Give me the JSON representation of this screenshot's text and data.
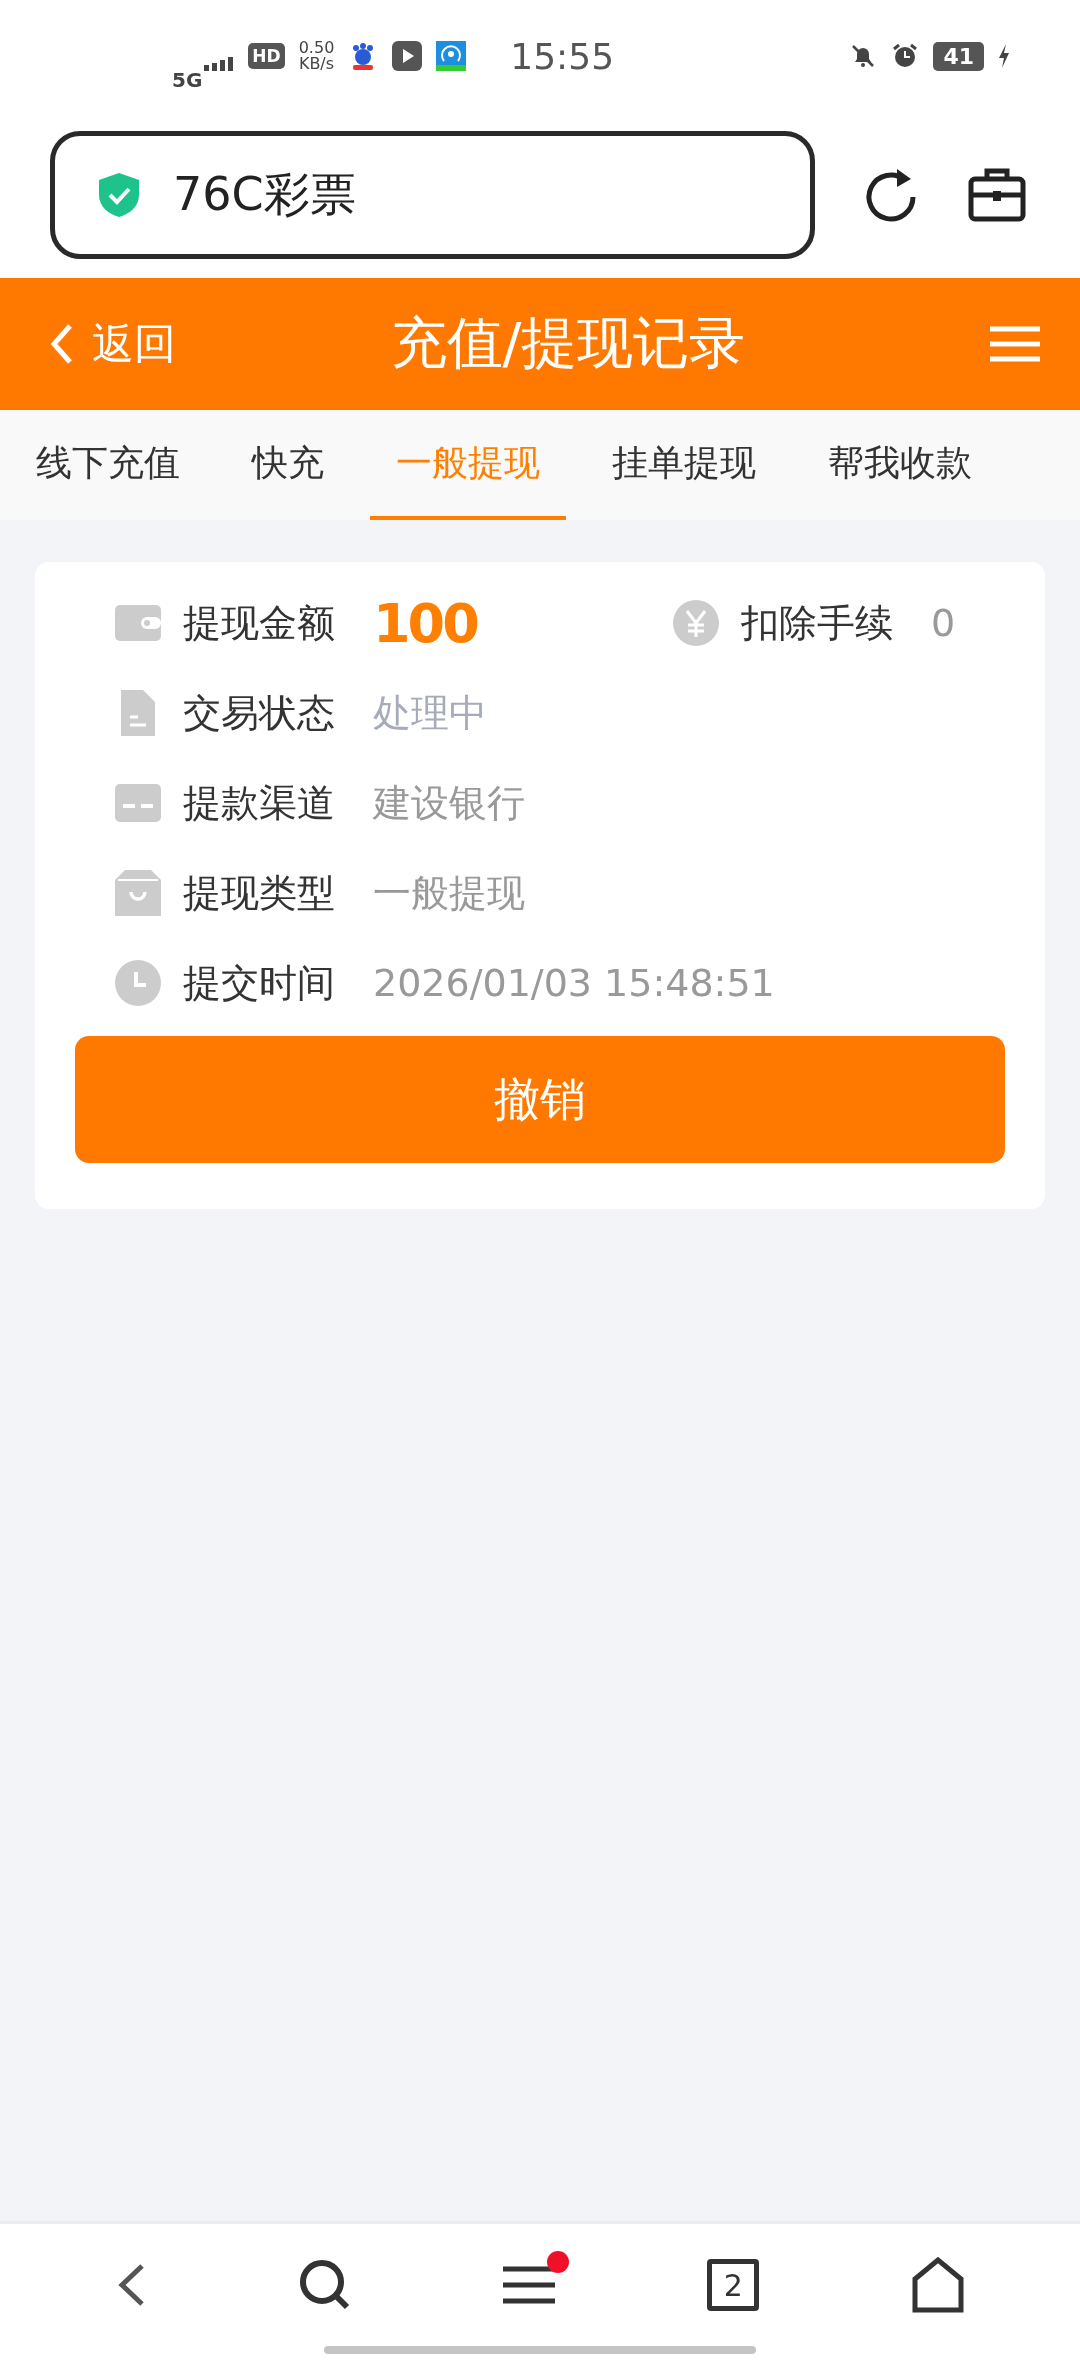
{
  "status_bar": {
    "network": "5G",
    "hd": "HD",
    "speed": "0.50",
    "speed_unit": "KB/s",
    "time": "15:55",
    "battery": "41"
  },
  "address_bar": {
    "title": "76C彩票"
  },
  "header": {
    "back": "返回",
    "title": "充值/提现记录"
  },
  "tabs": [
    {
      "label": "线下充值",
      "selected": false
    },
    {
      "label": "快充",
      "selected": false
    },
    {
      "label": "一般提现",
      "selected": true
    },
    {
      "label": "挂单提现",
      "selected": false
    },
    {
      "label": "帮我收款",
      "selected": false
    }
  ],
  "record": {
    "amount_label": "提现金额",
    "amount": "100",
    "fee_label": "扣除手续",
    "fee": "0",
    "rows": [
      {
        "kind": "status",
        "label": "交易状态",
        "value": "处理中"
      },
      {
        "kind": "channel",
        "label": "提款渠道",
        "value": "建设银行"
      },
      {
        "kind": "type",
        "label": "提现类型",
        "value": "一般提现"
      },
      {
        "kind": "time",
        "label": "提交时间",
        "value": "2026/01/03 15:48:51"
      }
    ],
    "button": "撤销"
  },
  "bottom_nav": {
    "tab_count": "2",
    "menu_badge": true
  }
}
